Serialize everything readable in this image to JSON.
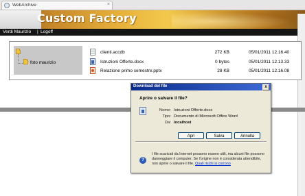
{
  "browser": {
    "tab_title": "WebArchive",
    "tab_close": "×"
  },
  "header": {
    "title": "Custom Factory"
  },
  "userbar": {
    "user": "Verdi Maurizio",
    "separator": "|",
    "logoff": "Logoff"
  },
  "folders": [
    {
      "label": "foto maurizio"
    }
  ],
  "files": [
    {
      "name": "clienti.accdb",
      "size": "272 KB",
      "date": "05/01/2011 12.16.40",
      "icon": "database-file-icon"
    },
    {
      "name": "Istruzioni Offerte.docx",
      "size": "0 bytes",
      "date": "05/01/2011 12.13.33",
      "icon": "word-document-icon"
    },
    {
      "name": "Relazione primo semestre.pptx",
      "size": "28 KB",
      "date": "05/01/2011 12.16.08",
      "icon": "powerpoint-file-icon"
    }
  ],
  "dialog": {
    "title": "Download del file",
    "close": "x",
    "question": "Aprire o salvare il file?",
    "name_label": "Nome:",
    "name_value": "Istruzioni Offerte.docx",
    "type_label": "Tipo:",
    "type_value": "Documento di Microsoft Office Word",
    "from_label": "Da:",
    "from_value": "localhost",
    "buttons": {
      "open": "Apri",
      "save": "Salva",
      "cancel": "Annulla"
    },
    "warning_text": "I file scaricati da Internet possono essere utili, ma alcuni file possono danneggiare il computer. Se l'origine non è considerata attendibile, non aprire o salvare il file.",
    "warning_link": "Quali rischi si corrono"
  }
}
